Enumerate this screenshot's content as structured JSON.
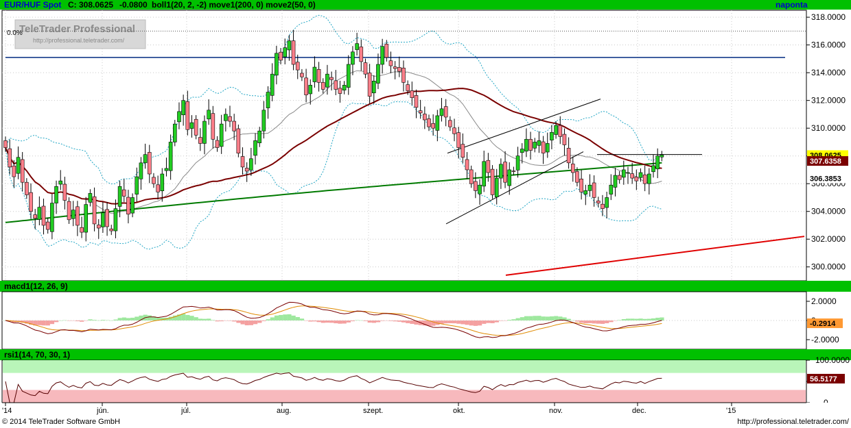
{
  "chart_data": [
    {
      "type": "candlestick",
      "panel": "price",
      "header": {
        "symbol": "EUR/HUF Spot",
        "quote": "C: 308.0625",
        "change": "-0.0800",
        "indicators": "boll1(20, 2, -2) move1(200, 0) move2(50, 0)",
        "period": "naponta"
      },
      "ylim": [
        299,
        318.5
      ],
      "yticks": [
        "300.0000",
        "302.0000",
        "304.0000",
        "306.0000",
        "308.0000",
        "310.0000",
        "312.0000",
        "314.0000",
        "316.0000",
        "318.0000"
      ],
      "ytick_values": [
        300,
        302,
        304,
        306,
        308,
        310,
        312,
        314,
        316,
        318
      ],
      "fib_label": "0.0%",
      "fib_level": 317,
      "resistance": 315.1,
      "value_labels": {
        "close": "308.0625",
        "ma50": "307.6358",
        "ma200": "306.3853"
      },
      "close_series": [
        308.6,
        307.2,
        306.5,
        307.9,
        306.1,
        305.2,
        304.0,
        303.5,
        304.3,
        303.0,
        302.7,
        304.6,
        305.8,
        306.2,
        304.8,
        303.4,
        304.1,
        303.0,
        302.5,
        304.5,
        305.3,
        303.1,
        302.8,
        303.9,
        302.9,
        302.6,
        304.2,
        305.8,
        305.1,
        303.8,
        305.0,
        306.5,
        307.5,
        308.1,
        306.7,
        306.0,
        305.4,
        306.7,
        307.1,
        309.0,
        310.3,
        311.2,
        312.0,
        309.9,
        310.4,
        309.5,
        308.9,
        310.5,
        311.3,
        309.2,
        308.6,
        310.3,
        311.0,
        310.5,
        309.8,
        308.2,
        307.2,
        306.9,
        307.8,
        309.1,
        309.8,
        311.3,
        312.6,
        313.9,
        315.4,
        314.9,
        315.8,
        316.3,
        314.6,
        314.2,
        313.7,
        312.4,
        313.1,
        314.4,
        313.3,
        312.8,
        313.9,
        313.5,
        312.8,
        312.5,
        313.1,
        314.6,
        315.5,
        316.1,
        314.8,
        313.9,
        312.3,
        313.4,
        314.6,
        315.9,
        315.1,
        314.5,
        314.3,
        314.1,
        313.3,
        312.7,
        312.2,
        311.5,
        311.1,
        310.6,
        310.1,
        310.0,
        310.9,
        311.4,
        310.8,
        310.1,
        309.6,
        308.6,
        307.9,
        307.0,
        306.0,
        305.5,
        305.9,
        307.6,
        306.8,
        305.2,
        306.4,
        307.4,
        306.1,
        307.0,
        306.9,
        308.0,
        308.5,
        309.2,
        308.4,
        309.0,
        309.1,
        308.2,
        308.9,
        309.7,
        310.2,
        309.4,
        308.8,
        307.5,
        306.8,
        306.1,
        305.4,
        305.5,
        305.9,
        305.0,
        304.6,
        304.2,
        305.0,
        305.9,
        306.6,
        306.3,
        307.0,
        306.8,
        306.4,
        306.2,
        306.8,
        306.0,
        306.7,
        307.3,
        308.0,
        308.0625
      ],
      "series": [
        {
          "name": "move1(200, 0)",
          "color": "#007a00"
        },
        {
          "name": "move2(50, 0)",
          "color": "#7a0000"
        },
        {
          "name": "boll1(20, 2, -2)",
          "color": "#1fa5c4"
        }
      ]
    },
    {
      "type": "line",
      "panel": "macd",
      "title": "macd1(12, 26, 9)",
      "ylim": [
        -3,
        3
      ],
      "yticks": [
        "2.0000",
        "0",
        "-2.0000"
      ],
      "ytick_values": [
        2,
        0,
        -2
      ],
      "value_label": "-0.2914"
    },
    {
      "type": "line",
      "panel": "rsi",
      "title": "rsi1(14, 70, 30, 1)",
      "ylim": [
        0,
        100
      ],
      "yticks": [
        "100.0000",
        "50",
        "0"
      ],
      "ytick_values": [
        100,
        50,
        0
      ],
      "value_label": "56.5177"
    }
  ],
  "x_axis": {
    "labels": [
      "'14",
      "jún.",
      "júl.",
      "aug.",
      "szept.",
      "okt.",
      "nov.",
      "dec.",
      "'15"
    ]
  },
  "watermark": {
    "title": "TeleTrader Professional",
    "url": "http://professional.teletrader.com/"
  },
  "footer": {
    "copyright": "© 2014 TeleTrader Software GmbH",
    "url": "http://professional.teletrader.com/"
  }
}
